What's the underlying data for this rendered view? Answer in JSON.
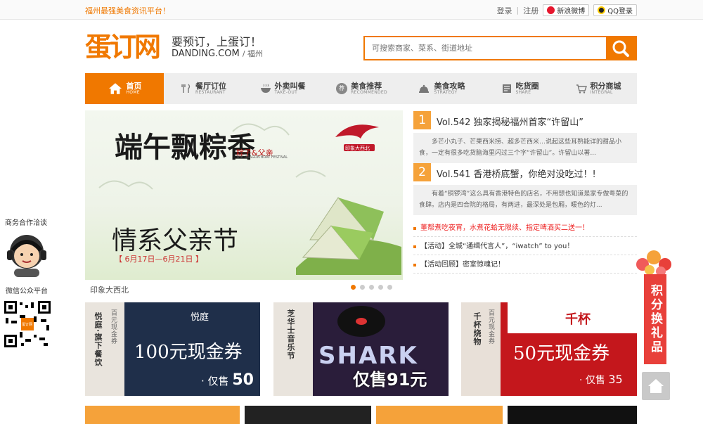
{
  "topbar": {
    "slogan": "福州最强美食资讯平台！",
    "login": "登录",
    "separator": "|",
    "register": "注册",
    "weibo": "新浪微博",
    "qq": "QQ登录"
  },
  "header": {
    "logo": "蛋订网",
    "tagline": "要预订，上蛋订！",
    "domain": "DANDING.COM",
    "city": "/ 福州",
    "search_placeholder": "可搜索商家、菜系、街道地址"
  },
  "nav": [
    {
      "cn": "首页",
      "en": "HOME",
      "icon": "home-icon",
      "active": true
    },
    {
      "cn": "餐厅订位",
      "en": "RESTAURANT",
      "icon": "cutlery-icon"
    },
    {
      "cn": "外卖叫餐",
      "en": "TAKE-OUT",
      "icon": "bowl-icon"
    },
    {
      "cn": "美食推荐",
      "en": "RECOMMENDED",
      "icon": "recommend-badge-icon",
      "badge": "荐"
    },
    {
      "cn": "美食攻略",
      "en": "STRATEGY",
      "icon": "dish-cover-icon"
    },
    {
      "cn": "吃货圈",
      "en": "SHARE",
      "icon": "note-icon"
    },
    {
      "cn": "积分商城",
      "en": "INTEGRAL",
      "icon": "cart-icon"
    }
  ],
  "banner": {
    "line1": "端午飘粽香",
    "line2": "情系父亲节",
    "sub": "粽子&父亲",
    "subtitle": "THE DRAGON BOAT FESTIVAL",
    "dates": "【 6月17日—6月21日 】",
    "caption": "印象大西北",
    "logo_text": "印象大西北"
  },
  "articles": [
    {
      "num": "1",
      "title": "Vol.542 独家揭秘福州首家“许留山”",
      "desc": "多芒小丸子、芒果西米捞、超多芒西米…说起这些耳熟能详的甜品小食，一定有很多吃货脑海里闪过三个字“许留山”。许留山以著..."
    },
    {
      "num": "2",
      "title": "Vol.541 香港桥底蟹，你绝对没吃过！!",
      "desc": "有着“铜锣湾”这么具有香港特色的店名，不用想也知道是家专做粤菜的食肆。店内是四合院的格局，有两进，最深处是包厢，暖色的灯..."
    }
  ],
  "news": [
    {
      "text": "董帮煮吃夜宵，水煮花蛤无限续、指定啤酒买二送一！",
      "red": true
    },
    {
      "text": "【活动】全城“通缉代言人”，“iwatch” to you！",
      "red": false
    },
    {
      "text": "【活动回顾】密室惊魂记！",
      "red": false
    }
  ],
  "coupons": [
    {
      "brand_v": "悦庭·旗下餐饮",
      "type_v": "百元现金券",
      "logo": "悦庭",
      "title": "100元现金券",
      "price_label": "· 仅售",
      "price": "50"
    },
    {
      "brand_v": "芝华士音乐节",
      "type_v": "",
      "logo": "SHARK",
      "title": "仅售91元",
      "price_label": "",
      "price": ""
    },
    {
      "brand_v": "千杯烧物",
      "type_v": "百元现金券",
      "logo": "千杯",
      "title": "50元现金券",
      "price_label": "· 仅售",
      "price": "35"
    }
  ],
  "left_float": {
    "business": "商务合作洽谈",
    "wechat": "微信公众平台",
    "qr_center": "蛋订网"
  },
  "right_float": {
    "points": "积分换礼品"
  },
  "colors": {
    "brand": "#f07800",
    "nav_bg": "#eeeeee",
    "coupon_navy": "#1f2f4a",
    "coupon_red": "#c4171c",
    "points_red": "#e8403a"
  }
}
